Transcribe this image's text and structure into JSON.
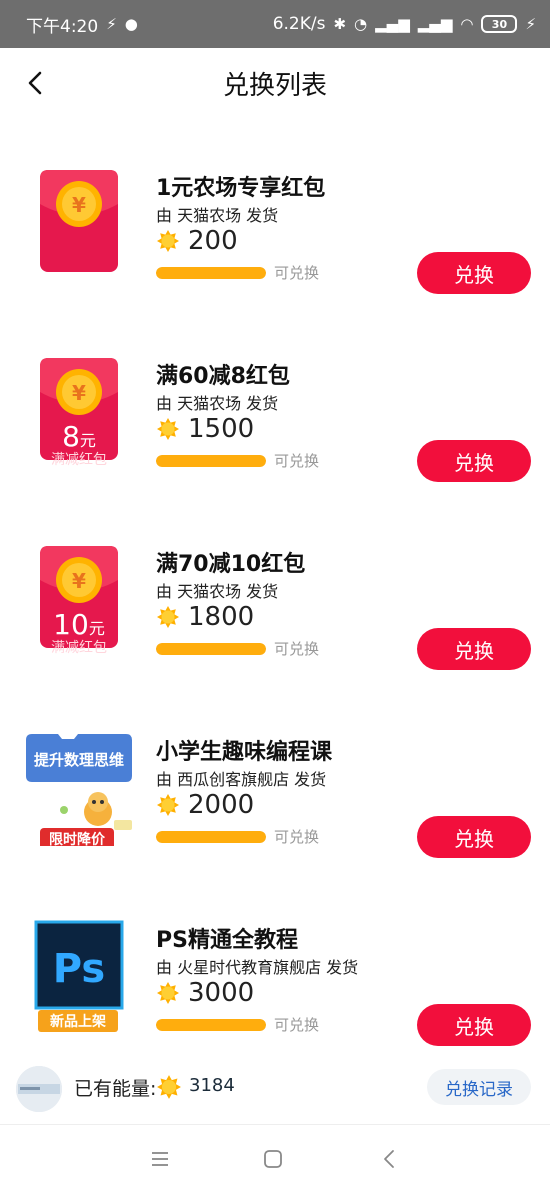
{
  "status_bar": {
    "time": "下午4:20",
    "network_speed": "6.2K/s",
    "battery": "30"
  },
  "header": {
    "title": "兑换列表"
  },
  "items": [
    {
      "thumb": "red-packet",
      "thumb_amount": "",
      "thumb_unit": "",
      "thumb_subtitle": "",
      "name": "1元农场专享红包",
      "seller": "由 天猫农场 发货",
      "price": "200",
      "progress": 1.0,
      "status": "可兑换",
      "button": "兑换"
    },
    {
      "thumb": "red-packet",
      "thumb_amount": "8",
      "thumb_unit": "元",
      "thumb_subtitle": "满减红包",
      "name": "满60减8红包",
      "seller": "由 天猫农场 发货",
      "price": "1500",
      "progress": 1.0,
      "status": "可兑换",
      "button": "兑换"
    },
    {
      "thumb": "red-packet",
      "thumb_amount": "10",
      "thumb_unit": "元",
      "thumb_subtitle": "满减红包",
      "name": "满70减10红包",
      "seller": "由 天猫农场 发货",
      "price": "1800",
      "progress": 1.0,
      "status": "可兑换",
      "button": "兑换"
    },
    {
      "thumb": "course",
      "thumb_title": "提升数理思维",
      "thumb_badge": "限时降价",
      "name": "小学生趣味编程课",
      "seller": "由 西瓜创客旗舰店 发货",
      "price": "2000",
      "progress": 1.0,
      "status": "可兑换",
      "button": "兑换"
    },
    {
      "thumb": "ps",
      "thumb_logo": "Ps",
      "thumb_badge": "新品上架",
      "name": "PS精通全教程",
      "seller": "由 火星时代教育旗舰店 发货",
      "price": "3000",
      "progress": 1.0,
      "status": "可兑换",
      "button": "兑换"
    }
  ],
  "footer": {
    "energy_label": "已有能量:",
    "energy_value": "3184",
    "record_button": "兑换记录"
  },
  "icons": {
    "status": [
      "lightning-icon",
      "wechat-icon",
      "bluetooth-icon",
      "alarm-icon",
      "signal-icon",
      "wifi-icon",
      "battery-icon",
      "charging-icon"
    ],
    "nav": [
      "back-icon"
    ],
    "coin": "energy-coin-icon",
    "system_nav": [
      "menu-icon",
      "home-icon",
      "back-icon"
    ]
  },
  "colors": {
    "accent": "#f20f3c",
    "progress": "#ffad0d",
    "coin": "#ffb000",
    "status_bar": "#6e6e6e",
    "link": "#2968c8"
  }
}
